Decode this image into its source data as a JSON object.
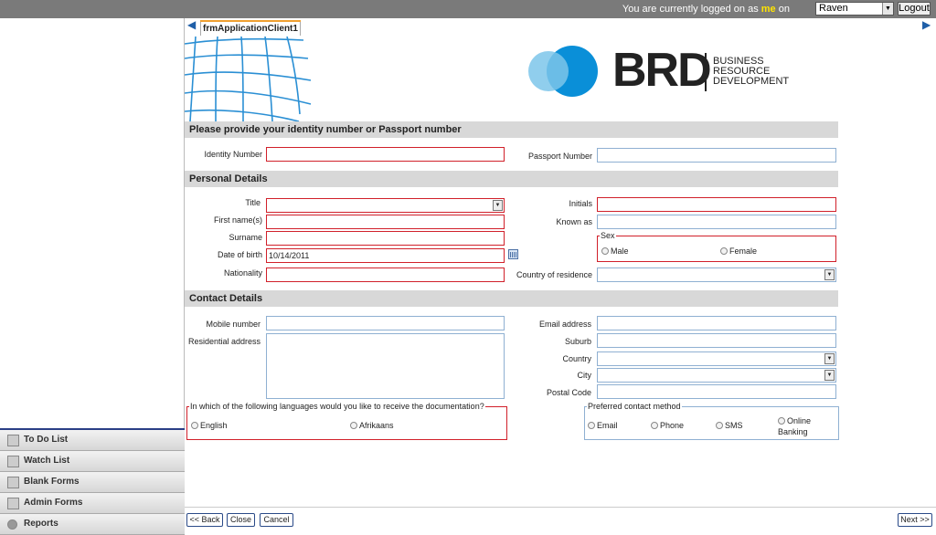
{
  "topbar": {
    "logged_prefix": "You are currently logged on as",
    "user_me": "me",
    "logged_suffix": "on",
    "user_select": "Raven",
    "logout": "Logout"
  },
  "sidebar": {
    "items": [
      {
        "label": "To Do List"
      },
      {
        "label": "Watch List"
      },
      {
        "label": "Blank Forms"
      },
      {
        "label": "Admin Forms"
      },
      {
        "label": "Reports"
      }
    ]
  },
  "tab": {
    "label": "frmApplicationClient1"
  },
  "logo": {
    "brd": "BRD",
    "line1": "BUSINESS",
    "line2": "RESOURCE",
    "line3": "DEVELOPMENT"
  },
  "identity": {
    "header": "Please provide your identity number or Passport number",
    "id_label": "Identity Number",
    "id_value": "",
    "passport_label": "Passport Number",
    "passport_value": ""
  },
  "personal": {
    "header": "Personal Details",
    "title_label": "Title",
    "title_value": "",
    "firstname_label": "First name(s)",
    "surname_label": "Surname",
    "dob_label": "Date of birth",
    "dob_value": "10/14/2011",
    "nationality_label": "Nationality",
    "initials_label": "Initials",
    "knownas_label": "Known as",
    "sex_legend": "Sex",
    "sex_male": "Male",
    "sex_female": "Female",
    "country_res_label": "Country of residence"
  },
  "contact": {
    "header": "Contact Details",
    "mobile_label": "Mobile number",
    "resaddr_label": "Residential address",
    "email_label": "Email address",
    "suburb_label": "Suburb",
    "country_label": "Country",
    "city_label": "City",
    "postal_label": "Postal Code",
    "lang_legend": "In which of the following languages would you like to receive the documentation?",
    "lang_english": "English",
    "lang_afrikaans": "Afrikaans",
    "pref_legend": "Preferred contact method",
    "pref_email": "Email",
    "pref_phone": "Phone",
    "pref_sms": "SMS",
    "pref_online_1": "Online",
    "pref_online_2": "Banking"
  },
  "buttons": {
    "back": "<< Back",
    "close": "Close",
    "cancel": "Cancel",
    "next": "Next >>"
  },
  "colors": {
    "required_border": "#d1202a",
    "field_border": "#8fb0d2",
    "logo_blue": "#0a8fd8",
    "logo_light_blue": "#7cc6ea"
  }
}
